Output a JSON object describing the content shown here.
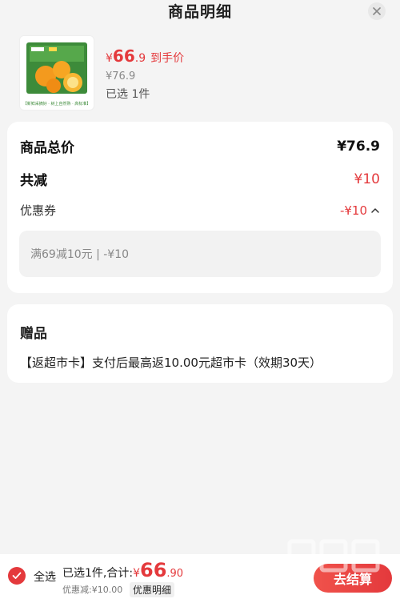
{
  "header": {
    "title": "商品明细"
  },
  "product": {
    "currency": "¥",
    "price_int": "66",
    "price_dec": ".9",
    "price_tag": "到手价",
    "original_price": "¥76.9",
    "selected_text": "已选 1件",
    "image_caption": "【新鲜采摘好 · 树上自然熟 · 高标准】"
  },
  "summary": {
    "total_label": "商品总价",
    "total_value": "¥76.9",
    "reduce_label": "共减",
    "reduce_value": "¥10",
    "coupon_label": "优惠券",
    "coupon_value": "-¥10",
    "coupon_detail": "满69减10元 | -¥10"
  },
  "gift": {
    "title": "赠品",
    "line": "【返超市卡】支付后最高返10.00元超市卡（效期30天）"
  },
  "bottom": {
    "select_all": "全选",
    "selected_total": "已选1件,合计:",
    "currency": "¥",
    "amount_int": "66",
    "amount_dec": ".90",
    "discount": "优惠减:¥10.00",
    "detail": "优惠明细",
    "checkout": "去结算"
  },
  "colors": {
    "accent": "#e4393c",
    "background": "#f4f4f4"
  },
  "icons": [
    "close-icon",
    "chevron-up-icon",
    "check-icon"
  ]
}
